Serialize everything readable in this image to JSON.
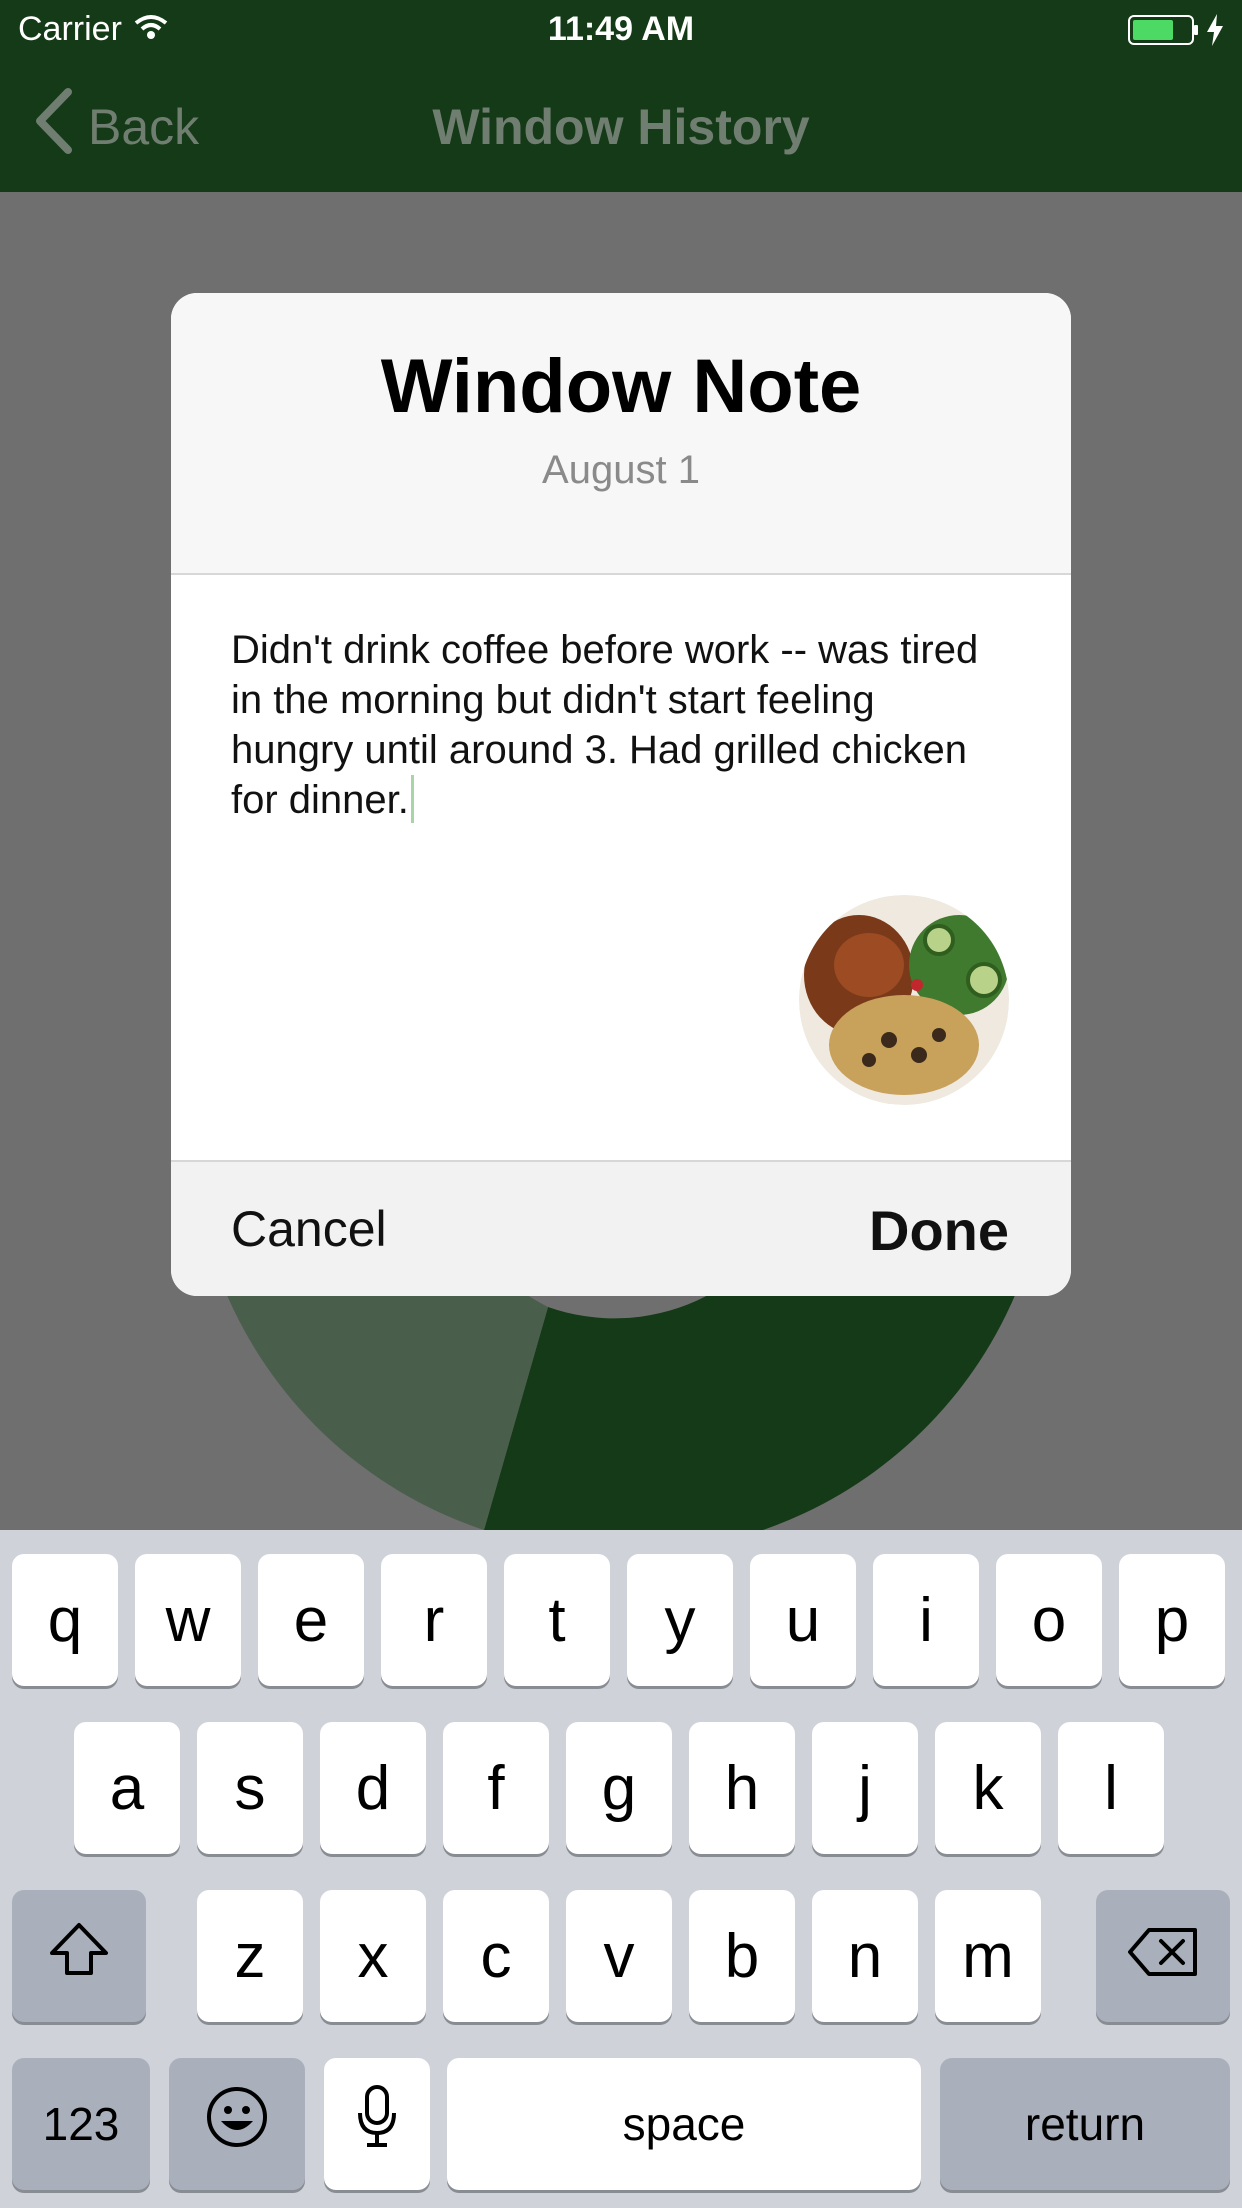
{
  "status_bar": {
    "carrier": "Carrier",
    "time": "11:49 AM",
    "icons": [
      "wifi-icon",
      "battery-icon",
      "charging-bolt-icon"
    ]
  },
  "nav": {
    "back_label": "Back",
    "title": "Window History"
  },
  "modal": {
    "title": "Window Note",
    "date": "August 1",
    "note_text": "Didn't drink coffee before work -- was tired in the morning but didn't start feeling hungry until around 3. Had grilled chicken for dinner.",
    "photo_icon": "food-photo",
    "cancel_label": "Cancel",
    "done_label": "Done"
  },
  "keyboard": {
    "row1": [
      "q",
      "w",
      "e",
      "r",
      "t",
      "y",
      "u",
      "i",
      "o",
      "p"
    ],
    "row2": [
      "a",
      "s",
      "d",
      "f",
      "g",
      "h",
      "j",
      "k",
      "l"
    ],
    "row3": [
      "z",
      "x",
      "c",
      "v",
      "b",
      "n",
      "m"
    ],
    "numbers_label": "123",
    "space_label": "space",
    "return_label": "return",
    "icons": [
      "shift-icon",
      "delete-icon",
      "emoji-icon",
      "microphone-icon"
    ]
  },
  "colors": {
    "nav_bg": "#153a17",
    "dim_overlay": "#6f6f6f",
    "keyboard_bg": "#cfd3d9"
  }
}
